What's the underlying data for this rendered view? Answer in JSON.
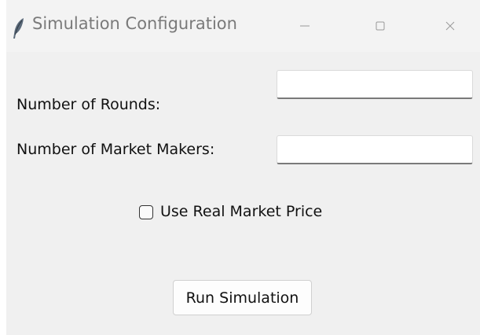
{
  "window": {
    "title": "Simulation Configuration",
    "icon": "feather-icon",
    "controls": {
      "minimize_icon": "minimize-icon",
      "maximize_icon": "maximize-icon",
      "close_icon": "close-icon"
    }
  },
  "form": {
    "rounds_label": "Number of Rounds:",
    "rounds_value": "",
    "makers_label": "Number of Market Makers:",
    "makers_value": "",
    "real_price_label": "Use Real Market Price",
    "real_price_checked": false,
    "run_button_label": "Run Simulation"
  },
  "colors": {
    "background": "#f0f0f0",
    "titlebar": "#f3f3f3",
    "title_text": "#7a7a7a"
  }
}
